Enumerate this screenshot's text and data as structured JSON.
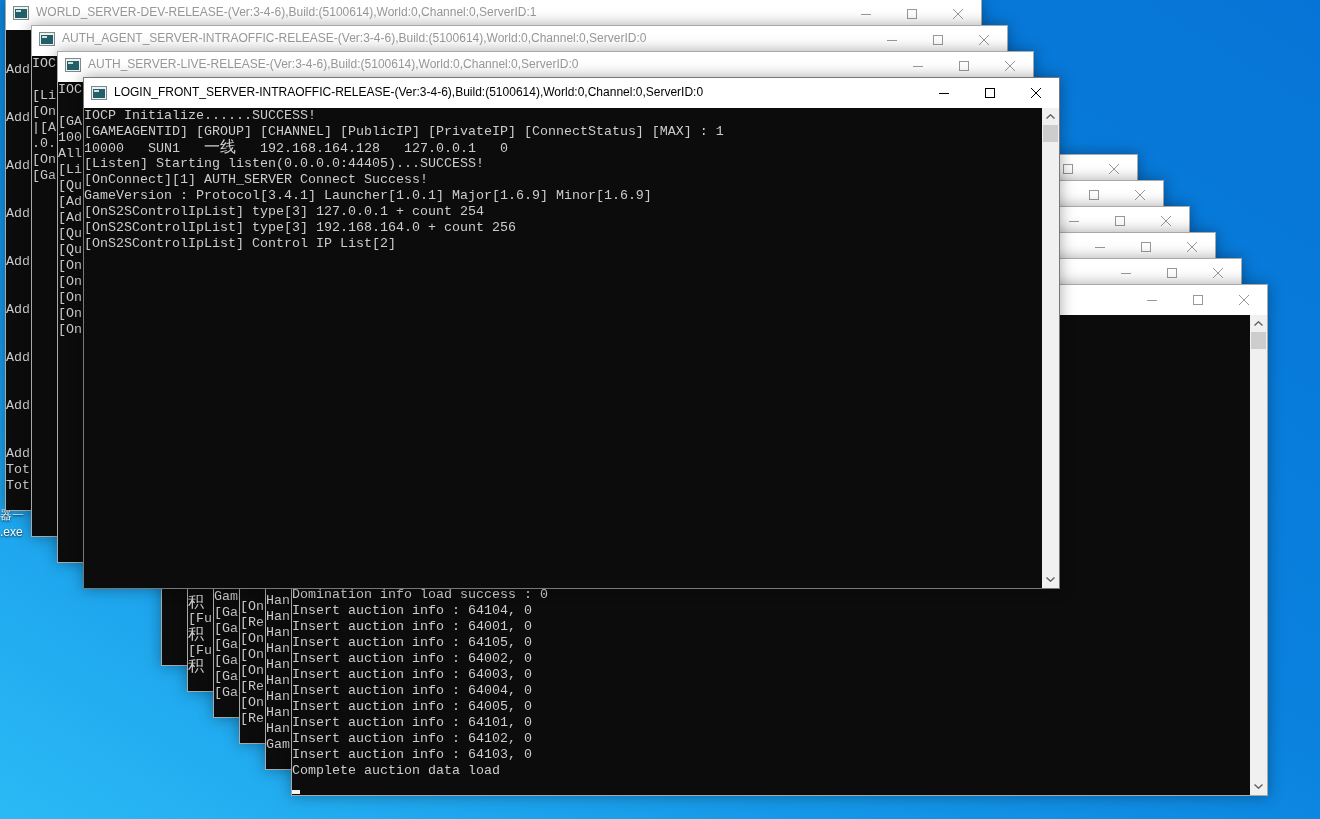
{
  "desktop": {
    "icon_labels": [
      "器一",
      ".exe"
    ]
  },
  "window_stacks": [
    {
      "windows": [
        {
          "title": "WORLD_SERVER-DEV-RELEASE-(Ver:3-4-6),Build:(5100614),World:0,Channel:0,ServerID:1",
          "active": false,
          "title_buttons": [
            {
              "kind": "minimize"
            },
            {
              "kind": "maximize"
            },
            {
              "kind": "close"
            }
          ],
          "lines": [
            {
              "kind": "blank"
            },
            {
              "kind": "blank"
            },
            {
              "kind": "text",
              "text": "Add"
            },
            {
              "kind": "blank"
            },
            {
              "kind": "blank"
            },
            {
              "kind": "text",
              "text": "Add"
            },
            {
              "kind": "blank"
            },
            {
              "kind": "blank"
            },
            {
              "kind": "text",
              "text": "Add"
            },
            {
              "kind": "blank"
            },
            {
              "kind": "blank"
            },
            {
              "kind": "text",
              "text": "Add"
            },
            {
              "kind": "blank"
            },
            {
              "kind": "blank"
            },
            {
              "kind": "text",
              "text": "Add"
            },
            {
              "kind": "blank"
            },
            {
              "kind": "blank"
            },
            {
              "kind": "text",
              "text": "Add"
            },
            {
              "kind": "blank"
            },
            {
              "kind": "blank"
            },
            {
              "kind": "text",
              "text": "Add"
            },
            {
              "kind": "blank"
            },
            {
              "kind": "blank"
            },
            {
              "kind": "text",
              "text": "Add"
            },
            {
              "kind": "blank"
            },
            {
              "kind": "blank"
            },
            {
              "kind": "text",
              "text": "Add"
            },
            {
              "kind": "text",
              "text": "Tot"
            },
            {
              "kind": "text",
              "text": "Tot"
            }
          ]
        },
        {
          "title": "AUTH_AGENT_SERVER-INTRAOFFIC-RELEASE-(Ver:3-4-6),Build:(5100614),World:0,Channel:0,ServerID:0",
          "active": false,
          "title_buttons": [
            {
              "kind": "minimize"
            },
            {
              "kind": "maximize"
            },
            {
              "kind": "close"
            }
          ],
          "lines": [
            {
              "kind": "text",
              "text": "IOC"
            },
            {
              "kind": "blank"
            },
            {
              "kind": "text",
              "text": "[Li"
            },
            {
              "kind": "text",
              "text": "[On"
            },
            {
              "kind": "text",
              "text": "|[A"
            },
            {
              "kind": "text",
              "text": ".0."
            },
            {
              "kind": "text",
              "text": "[On"
            },
            {
              "kind": "text",
              "text": "[Ga"
            }
          ]
        },
        {
          "title": "AUTH_SERVER-LIVE-RELEASE-(Ver:3-4-6),Build:(5100614),World:0,Channel:0,ServerID:0",
          "active": false,
          "title_buttons": [
            {
              "kind": "minimize"
            },
            {
              "kind": "maximize"
            },
            {
              "kind": "close"
            }
          ],
          "lines": [
            {
              "kind": "text",
              "text": "IOC"
            },
            {
              "kind": "blank"
            },
            {
              "kind": "text",
              "text": "[GA"
            },
            {
              "kind": "text",
              "text": "100"
            },
            {
              "kind": "text",
              "text": "All"
            },
            {
              "kind": "text",
              "text": "[Li"
            },
            {
              "kind": "text",
              "text": "[Qu"
            },
            {
              "kind": "text",
              "text": "[Ad"
            },
            {
              "kind": "text",
              "text": "[Ad"
            },
            {
              "kind": "text",
              "text": "[Qu"
            },
            {
              "kind": "text",
              "text": "[Qu"
            },
            {
              "kind": "text",
              "text": "[On"
            },
            {
              "kind": "text",
              "text": "[On"
            },
            {
              "kind": "text",
              "text": "[On"
            },
            {
              "kind": "text",
              "text": "[On"
            },
            {
              "kind": "text",
              "text": "[On"
            }
          ]
        },
        {
          "title": "LOGIN_FRONT_SERVER-INTRAOFFIC-RELEASE-(Ver:3-4-6),Build:(5100614),World:0,Channel:0,ServerID:0",
          "active": true,
          "title_buttons": [
            {
              "kind": "minimize"
            },
            {
              "kind": "maximize"
            },
            {
              "kind": "close"
            }
          ],
          "scrollbar": true,
          "cursor": false,
          "lines": [
            {
              "kind": "text",
              "text": "IOCP Initialize......SUCCESS!"
            },
            {
              "kind": "text",
              "text": "[GAMEAGENTID] [GROUP] [CHANNEL] [PublicIP] [PrivateIP] [ConnectStatus] [MAX] : 1"
            },
            {
              "kind": "text",
              "text": "10000   SUN1   一线   192.168.164.128   127.0.0.1   0"
            },
            {
              "kind": "text",
              "text": "[Listen] Starting listen(0.0.0.0:44405)...SUCCESS!"
            },
            {
              "kind": "text",
              "text": "[OnConnect][1] AUTH_SERVER Connect Success!"
            },
            {
              "kind": "text",
              "text": "GameVersion : Protocol[3.4.1] Launcher[1.0.1] Major[1.6.9] Minor[1.6.9]"
            },
            {
              "kind": "text",
              "text": "[OnS2SControlIpList] type[3] 127.0.0.1 + count 254"
            },
            {
              "kind": "text",
              "text": "[OnS2SControlIpList] type[3] 192.168.164.0 + count 256"
            },
            {
              "kind": "text",
              "text": "[OnS2SControlIpList] Control IP List[2]"
            }
          ]
        }
      ]
    },
    {
      "windows": [
        {
          "active": false,
          "title_buttons": [
            {
              "kind": "maximize"
            },
            {
              "kind": "close"
            }
          ]
        },
        {
          "active": false,
          "title_buttons": [
            {
              "kind": "maximize"
            },
            {
              "kind": "close"
            }
          ],
          "cursor": false,
          "lines": [
            {
              "kind": "text",
              "text": "积"
            },
            {
              "kind": "text",
              "text": "[Fu"
            },
            {
              "kind": "text",
              "text": "积"
            },
            {
              "kind": "text",
              "text": "[Fu"
            },
            {
              "kind": "text",
              "text": "积"
            },
            {
              "kind": "blank"
            }
          ]
        },
        {
          "active": false,
          "title_buttons": [
            {
              "kind": "minimize"
            },
            {
              "kind": "maximize"
            },
            {
              "kind": "close"
            }
          ],
          "cursor": false,
          "lines": [
            {
              "kind": "text",
              "text": "Gam"
            },
            {
              "kind": "text",
              "text": "[Ga"
            },
            {
              "kind": "text",
              "text": "[Ga"
            },
            {
              "kind": "text",
              "text": "[Ga"
            },
            {
              "kind": "text",
              "text": "[Ga"
            },
            {
              "kind": "text",
              "text": "[Ga"
            },
            {
              "kind": "text",
              "text": "[Ga"
            },
            {
              "kind": "blank"
            }
          ]
        },
        {
          "active": false,
          "title_buttons": [
            {
              "kind": "minimize"
            },
            {
              "kind": "maximize"
            },
            {
              "kind": "close"
            }
          ],
          "cursor": false,
          "lines": [
            {
              "kind": "text",
              "text": "[On"
            },
            {
              "kind": "text",
              "text": "[Re"
            },
            {
              "kind": "text",
              "text": "[On"
            },
            {
              "kind": "text",
              "text": "[On"
            },
            {
              "kind": "text",
              "text": "[On"
            },
            {
              "kind": "text",
              "text": "[Re"
            },
            {
              "kind": "text",
              "text": "[On"
            },
            {
              "kind": "text",
              "text": "[Re"
            },
            {
              "kind": "blank"
            }
          ]
        },
        {
          "active": false,
          "title_buttons": [
            {
              "kind": "minimize"
            },
            {
              "kind": "maximize"
            },
            {
              "kind": "close"
            }
          ],
          "cursor": false,
          "lines": [
            {
              "kind": "text",
              "text": "Han"
            },
            {
              "kind": "text",
              "text": "Han"
            },
            {
              "kind": "text",
              "text": "Han"
            },
            {
              "kind": "text",
              "text": "Han"
            },
            {
              "kind": "text",
              "text": "Han"
            },
            {
              "kind": "text",
              "text": "Han"
            },
            {
              "kind": "text",
              "text": "Han"
            },
            {
              "kind": "text",
              "text": "Han"
            },
            {
              "kind": "text",
              "text": "Han"
            },
            {
              "kind": "text",
              "text": "Gam"
            },
            {
              "kind": "blank"
            }
          ]
        },
        {
          "active": false,
          "title_buttons": [
            {
              "kind": "minimize"
            },
            {
              "kind": "maximize"
            },
            {
              "kind": "close"
            }
          ],
          "scrollbar": true,
          "cursor": true,
          "lines": [
            {
              "kind": "text",
              "text": "Domination info load success : 0"
            },
            {
              "kind": "text",
              "text": "Insert auction info : 64104, 0"
            },
            {
              "kind": "text",
              "text": "Insert auction info : 64001, 0"
            },
            {
              "kind": "text",
              "text": "Insert auction info : 64105, 0"
            },
            {
              "kind": "text",
              "text": "Insert auction info : 64002, 0"
            },
            {
              "kind": "text",
              "text": "Insert auction info : 64003, 0"
            },
            {
              "kind": "text",
              "text": "Insert auction info : 64004, 0"
            },
            {
              "kind": "text",
              "text": "Insert auction info : 64005, 0"
            },
            {
              "kind": "text",
              "text": "Insert auction info : 64101, 0"
            },
            {
              "kind": "text",
              "text": "Insert auction info : 64102, 0"
            },
            {
              "kind": "text",
              "text": "Insert auction info : 64103, 0"
            },
            {
              "kind": "text",
              "text": "Complete auction data load"
            }
          ]
        }
      ]
    }
  ]
}
